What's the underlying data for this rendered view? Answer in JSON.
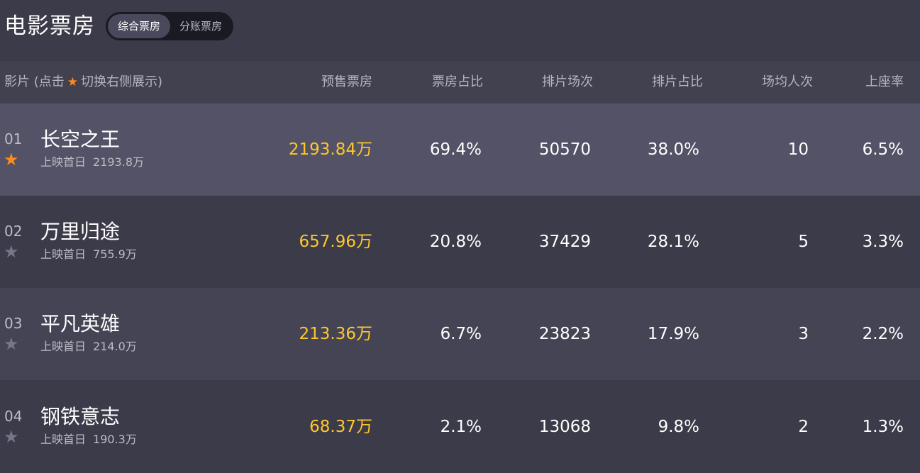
{
  "header": {
    "title": "电影票房",
    "tabs": [
      {
        "label": "综合票房",
        "active": true
      },
      {
        "label": "分账票房",
        "active": false
      }
    ]
  },
  "columns": {
    "film": {
      "prefix": "影片 (点击",
      "suffix": "切换右侧展示)"
    },
    "presale": "预售票房",
    "box_share": "票房占比",
    "screenings": "排片场次",
    "screen_share": "排片占比",
    "avg_attendance": "场均人次",
    "occupancy": "上座率"
  },
  "colors": {
    "star_active": "#ff8c1a",
    "star_inactive": "#78778a",
    "presale_text": "#ffc72b",
    "row_highlight": "#535266",
    "row_odd": "#3c3b4a",
    "row_even": "#454455"
  },
  "rows": [
    {
      "rank": "01",
      "starred": true,
      "name": "长空之王",
      "sub_label": "上映首日",
      "sub_value": "2193.8万",
      "presale": "2193.84万",
      "box_share": "69.4%",
      "screenings": "50570",
      "screen_share": "38.0%",
      "avg_attendance": "10",
      "occupancy": "6.5%"
    },
    {
      "rank": "02",
      "starred": false,
      "name": "万里归途",
      "sub_label": "上映首日",
      "sub_value": "755.9万",
      "presale": "657.96万",
      "box_share": "20.8%",
      "screenings": "37429",
      "screen_share": "28.1%",
      "avg_attendance": "5",
      "occupancy": "3.3%"
    },
    {
      "rank": "03",
      "starred": false,
      "name": "平凡英雄",
      "sub_label": "上映首日",
      "sub_value": "214.0万",
      "presale": "213.36万",
      "box_share": "6.7%",
      "screenings": "23823",
      "screen_share": "17.9%",
      "avg_attendance": "3",
      "occupancy": "2.2%"
    },
    {
      "rank": "04",
      "starred": false,
      "name": "钢铁意志",
      "sub_label": "上映首日",
      "sub_value": "190.3万",
      "presale": "68.37万",
      "box_share": "2.1%",
      "screenings": "13068",
      "screen_share": "9.8%",
      "avg_attendance": "2",
      "occupancy": "1.3%"
    }
  ]
}
